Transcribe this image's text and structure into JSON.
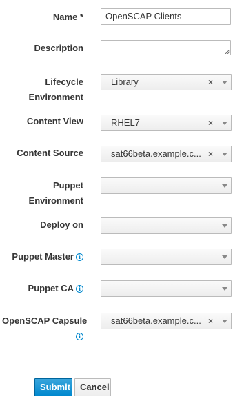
{
  "form": {
    "name": {
      "label": "Name *",
      "value": "OpenSCAP Clients"
    },
    "description": {
      "label": "Description",
      "value": ""
    },
    "lifecycle_environment": {
      "label_line1": "Lifecycle",
      "label_line2": "Environment",
      "value": "Library"
    },
    "content_view": {
      "label": "Content View",
      "value": "RHEL7"
    },
    "content_source": {
      "label": "Content Source",
      "value": "sat66beta.example.c..."
    },
    "puppet_environment": {
      "label_line1": "Puppet",
      "label_line2": "Environment",
      "value": ""
    },
    "deploy_on": {
      "label": "Deploy on",
      "value": ""
    },
    "puppet_master": {
      "label": "Puppet Master",
      "value": ""
    },
    "puppet_ca": {
      "label": "Puppet CA",
      "value": ""
    },
    "openscap_capsule": {
      "label": "OpenSCAP Capsule",
      "value": "sat66beta.example.c..."
    }
  },
  "actions": {
    "submit_label": "Submit",
    "cancel_label": "Cancel"
  },
  "icons": {
    "info": "info-circle-icon",
    "clear": "clear-x-icon",
    "dropdown": "chevron-down-icon"
  },
  "colors": {
    "primary": "#0088ce",
    "info": "#0088ce"
  }
}
